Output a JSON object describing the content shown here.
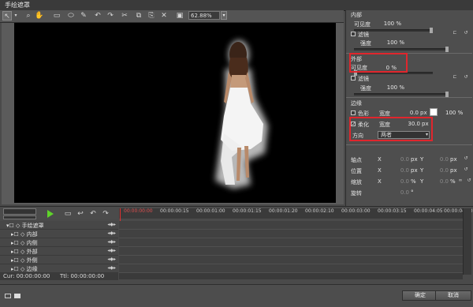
{
  "window": {
    "title": "手绘遮罩"
  },
  "toolbar": {
    "tools": [
      "arrow-icon",
      "magnifier-icon",
      "hand-icon",
      "rectangle-icon",
      "ellipse-icon",
      "pen-icon",
      "undo-icon",
      "redo-icon",
      "cut-icon",
      "copy-icon",
      "paste-icon",
      "delete-icon",
      "fit-icon"
    ],
    "zoom": "62.88%"
  },
  "panel": {
    "inner": {
      "title": "内部",
      "visibility_label": "可见度",
      "visibility": "100 %",
      "filter_label": "滤镜",
      "strength_label": "强度",
      "strength": "100 %"
    },
    "outer": {
      "title": "外部",
      "visibility_label": "可见度",
      "visibility": "0 %",
      "filter_label": "滤镜",
      "strength_label": "强度",
      "strength": "100 %"
    },
    "edge": {
      "title": "边缘",
      "color_label": "色彩",
      "width_label": "宽度",
      "color_width": "0.0",
      "unit": "px",
      "color_pct": "100 %",
      "color_hex": "#ffffff",
      "soften_label": "柔化",
      "soften_width": "30.0",
      "soften_checked": true,
      "direction_label": "方向",
      "direction": "两者"
    },
    "transform": {
      "anchor_label": "轴点",
      "position_label": "位置",
      "scale_label": "缩放",
      "rotate_label": "旋转",
      "x": "X",
      "y": "Y",
      "anchor_x": "0.0",
      "anchor_y": "0.0",
      "position_x": "0.0",
      "position_y": "0.0",
      "scale_x": "0.0",
      "scale_y": "0.0",
      "px": "px",
      "pct": "%",
      "rotate": "0.0",
      "deg": "°"
    }
  },
  "timeline": {
    "ruler": [
      "00:00:00:00",
      "00:00:00:15",
      "00:00:01:00",
      "00:00:01:15",
      "00:00:01:20",
      "00:00:02:10",
      "00:00:03:00",
      "00:00:03:15",
      "00:00:04:05",
      "00:00:04:20"
    ],
    "tracks": [
      {
        "name": "手绘遮罩",
        "level": 0
      },
      {
        "name": "内部",
        "level": 1
      },
      {
        "name": "内侧",
        "level": 1
      },
      {
        "name": "外部",
        "level": 1
      },
      {
        "name": "外侧",
        "level": 1
      },
      {
        "name": "边缘",
        "level": 1
      }
    ],
    "track_controls": "◂◆▸",
    "cur": "Cur: 00:00:00:00",
    "ttl": "Ttl: 00:00:00:00"
  },
  "footer": {
    "ok": "确定",
    "cancel": "取消"
  }
}
